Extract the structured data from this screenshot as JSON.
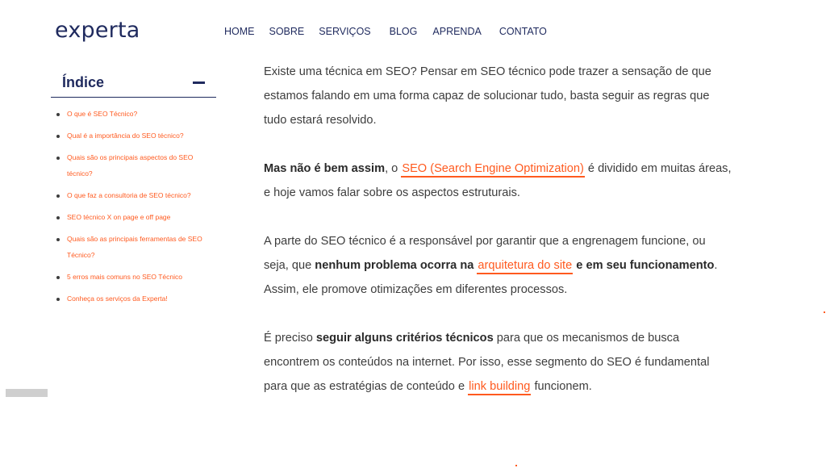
{
  "brand": {
    "logo_text": "experta"
  },
  "nav": {
    "items": [
      "HOME",
      "SOBRE",
      "SERVIÇOS",
      "BLOG",
      "APRENDA",
      "CONTATO"
    ]
  },
  "toc": {
    "title": "Índice",
    "items": [
      "O que é SEO Técnico?",
      "Qual é a importância do SEO técnico?",
      "Quais são os principais aspectos do SEO técnico?",
      "O que faz a consultoria de SEO técnico?",
      "SEO técnico X on page e off page",
      "Quais são as principais ferramentas de SEO Técnico?",
      "5 erros mais comuns no SEO Técnico",
      "Conheça os serviços da Experta!"
    ]
  },
  "article": {
    "p1": "Existe uma técnica em SEO? Pensar em SEO técnico pode trazer a sensação de que estamos falando em uma forma capaz de solucionar tudo, basta seguir as regras que tudo estará resolvido.",
    "p2": {
      "bold": "Mas não é bem assim",
      "t1": ", o ",
      "link": "SEO (Search Engine Optimization)",
      "t2": " é dividido em muitas áreas, e hoje vamos falar sobre os aspectos estruturais."
    },
    "p3": {
      "t1": "A parte do SEO técnico é a responsável por garantir que a engrenagem funcione, ou seja, que ",
      "bold1": "nenhum problema ocorra na ",
      "link": "arquitetura do site",
      "bold2": " e em seu funcionamento",
      "t2": ". Assim, ele promove otimizações em diferentes processos."
    },
    "p4": {
      "t1": "É preciso ",
      "bold": "seguir alguns critérios técnicos",
      "t2": " para que os mecanismos de busca encontrem os conteúdos na internet. Por isso, esse segmento do SEO é fundamental para que as estratégias de conteúdo e ",
      "link": "link building",
      "t3": " funcionem."
    }
  },
  "colors": {
    "brand_navy": "#1f2a5e",
    "accent_orange": "#ff5a1f",
    "text": "#3d3d3d"
  }
}
